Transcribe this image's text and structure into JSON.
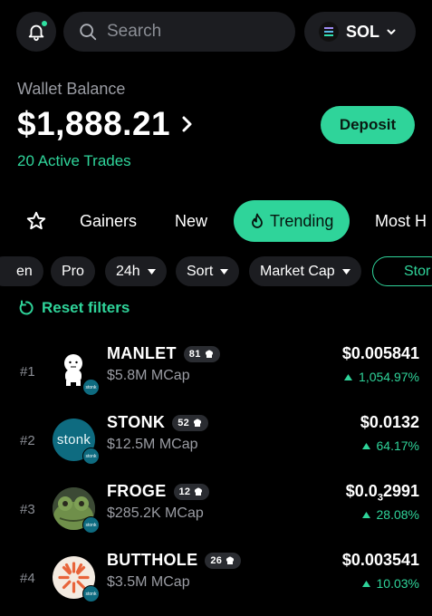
{
  "header": {
    "search_placeholder": "Search",
    "chain": "SOL"
  },
  "wallet": {
    "label": "Wallet Balance",
    "amount": "$1,888.21",
    "active_trades": "20 Active Trades",
    "deposit_label": "Deposit"
  },
  "tabs": {
    "gainers": "Gainers",
    "new": "New",
    "trending": "Trending",
    "most": "Most H"
  },
  "filters": {
    "partial": "en",
    "pro": "Pro",
    "timeframe": "24h",
    "sort": "Sort",
    "market_cap": "Market Cap",
    "outline_partial": "Stor",
    "reset": "Reset filters"
  },
  "tokens": [
    {
      "rank": "#1",
      "name": "MANLET",
      "holders": "81",
      "mcap": "$5.8M MCap",
      "price": "$0.005841",
      "change": "1,054.97%"
    },
    {
      "rank": "#2",
      "name": "STONK",
      "holders": "52",
      "mcap": "$12.5M MCap",
      "price": "$0.0132",
      "change": "64.17%"
    },
    {
      "rank": "#3",
      "name": "FROGE",
      "holders": "12",
      "mcap": "$285.2K MCap",
      "price_main": "$0.0",
      "price_sub": "3",
      "price_rest": "2991",
      "change": "28.08%"
    },
    {
      "rank": "#4",
      "name": "BUTTHOLE",
      "holders": "26",
      "mcap": "$3.5M MCap",
      "price": "$0.003541",
      "change": "10.03%"
    }
  ],
  "badge_text": "stonk",
  "avatar_text": "stonk",
  "colors": {
    "accent": "#2fd49a",
    "surface": "#1c1d21",
    "background": "#000000"
  }
}
